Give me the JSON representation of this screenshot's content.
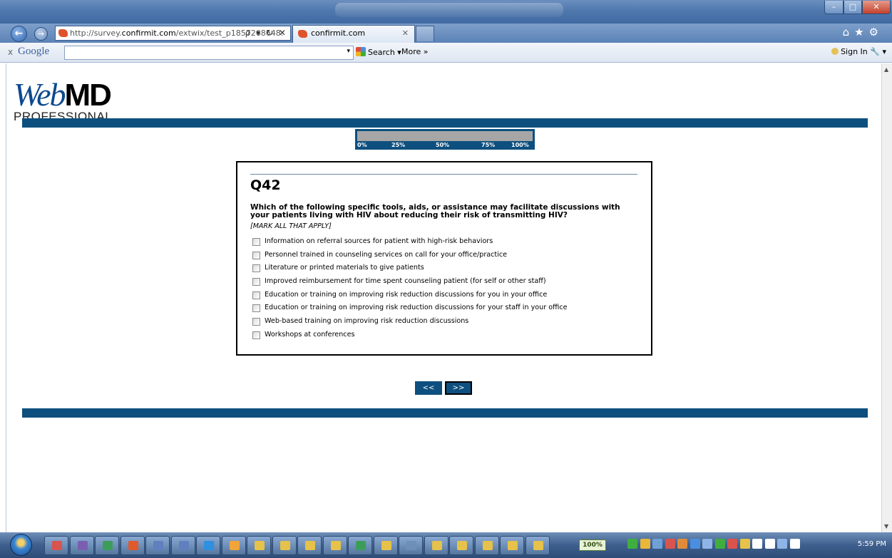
{
  "browser": {
    "url_prefix": "http://survey.",
    "url_host": "confirmit.com",
    "url_path": "/extwix/test_p1857268648.",
    "url_controls": "ρ ▾ ↻ ✕",
    "tab_title": "confirmit.com",
    "tab_close": "✕",
    "back_glyph": "←",
    "forward_glyph": "→",
    "right_icons": "⌂★⚙",
    "window_min": "–",
    "window_max": "□",
    "window_close": "✕"
  },
  "google_toolbar": {
    "close": "x",
    "logo": "Google",
    "search_value": "",
    "dropdown": "▾",
    "search_label": "Search",
    "search_arrow": "▾",
    "more_label": "More »",
    "sign_in": "Sign In",
    "wrench": "🔧 ▾"
  },
  "logo": {
    "web": "Web",
    "md": "MD",
    "professional": "PROFESSIONAL"
  },
  "progress": {
    "fraction": 0.0,
    "ticks": [
      "0%",
      "25%",
      "50%",
      "75%",
      "100%"
    ]
  },
  "question": {
    "number": "Q42",
    "text": "Which of the following specific tools, aids, or assistance may facilitate discussions with your patients living with HIV about reducing their risk of transmitting HIV?",
    "instruction": "[MARK ALL THAT APPLY]",
    "options": [
      "Information on referral sources for patient with high-risk behaviors",
      "Personnel trained in counseling services on call for your office/practice",
      "Literature or printed materials to give patients",
      "Improved reimbursement for time spent counseling patient (for self or other staff)",
      "Education or training on improving risk reduction discussions for you in your office",
      "Education or training on improving risk reduction discussions for your staff in your office",
      "Web-based training on improving risk reduction discussions",
      "Workshops at conferences"
    ]
  },
  "nav": {
    "prev": "<<",
    "next": ">>"
  },
  "taskbar": {
    "battery": "100%",
    "clock": "5:59 PM",
    "app_colors": [
      "#d9534f",
      "#7a5fb0",
      "#3c9d5b",
      "#e05a2b",
      "#5f7fbf",
      "#5f7fbf",
      "#2f8fe0",
      "#f0a43a",
      "#e6c24a",
      "#e6c24a",
      "#e6c24a",
      "#e6c24a",
      "#3c9d5b",
      "#e6c24a",
      "#6d8fb8",
      "#e6c24a",
      "#e6c24a",
      "#e6c24a",
      "#e6c24a",
      "#e6c24a"
    ],
    "tray_colors": [
      "#3fae3f",
      "#e8b73a",
      "#6fa0d8",
      "#d9534f",
      "#e08b3a",
      "#4a8fdf",
      "#8fb4e6",
      "#3fae3f",
      "#d9534f",
      "#e6c24a",
      "#ffffff",
      "#ffffff",
      "#8fb4e6",
      "#ffffff"
    ]
  }
}
